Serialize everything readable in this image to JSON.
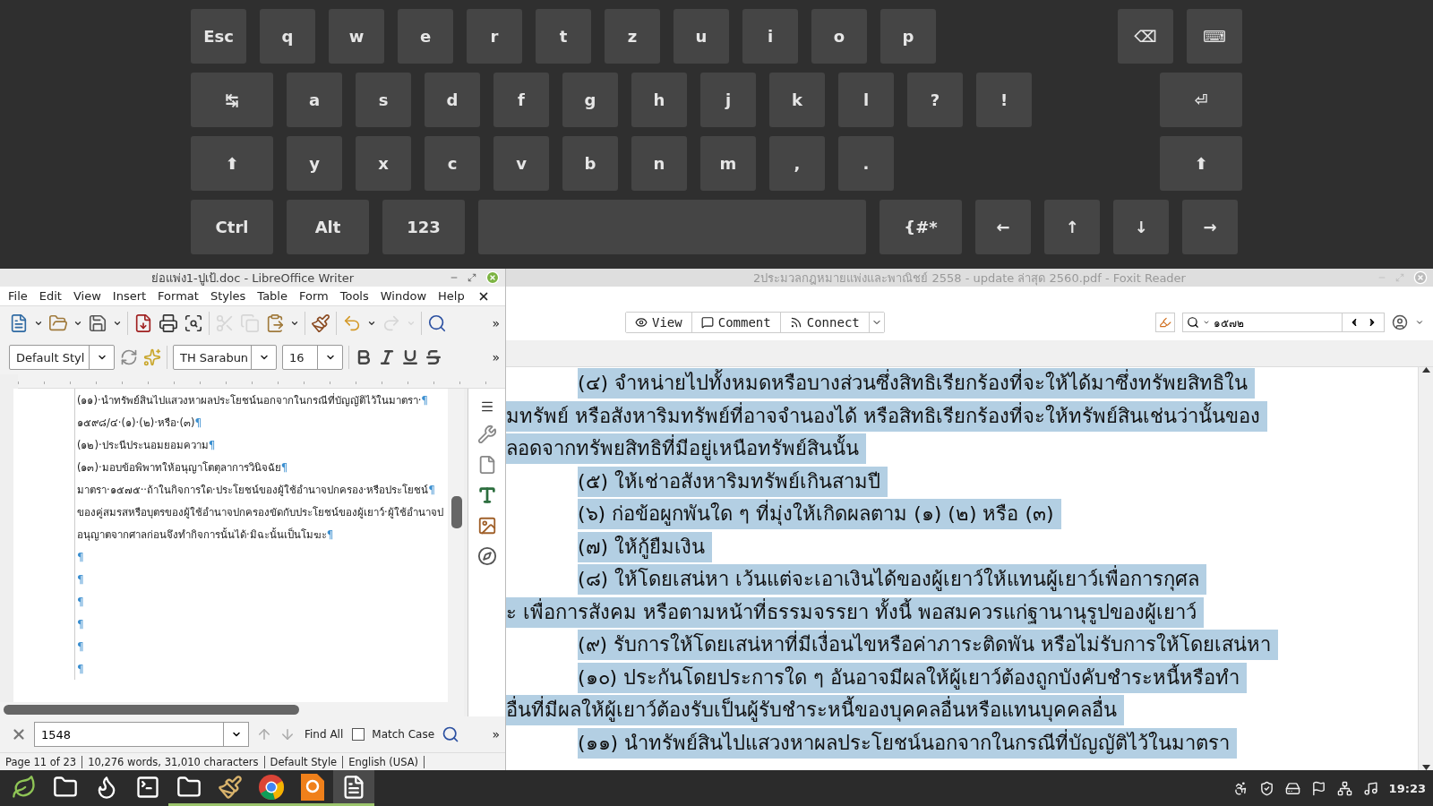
{
  "keyboard": {
    "rows": [
      {
        "left": [
          {
            "label": "Esc",
            "kind": "key"
          },
          {
            "label": "q",
            "kind": "key"
          },
          {
            "label": "w",
            "kind": "key"
          },
          {
            "label": "e",
            "kind": "key"
          },
          {
            "label": "r",
            "kind": "key"
          },
          {
            "label": "t",
            "kind": "key"
          },
          {
            "label": "z",
            "kind": "key"
          },
          {
            "label": "u",
            "kind": "key"
          },
          {
            "label": "i",
            "kind": "key"
          },
          {
            "label": "o",
            "kind": "key"
          },
          {
            "label": "p",
            "kind": "key"
          }
        ],
        "right": [
          {
            "label": "⌫",
            "kind": "key"
          },
          {
            "label": "⌨",
            "kind": "key"
          }
        ]
      },
      {
        "left": [
          {
            "label": "↹",
            "kind": "wide"
          },
          {
            "label": "a",
            "kind": "key"
          },
          {
            "label": "s",
            "kind": "key"
          },
          {
            "label": "d",
            "kind": "key"
          },
          {
            "label": "f",
            "kind": "key"
          },
          {
            "label": "g",
            "kind": "key"
          },
          {
            "label": "h",
            "kind": "key"
          },
          {
            "label": "j",
            "kind": "key"
          },
          {
            "label": "k",
            "kind": "key"
          },
          {
            "label": "l",
            "kind": "key"
          },
          {
            "label": "?",
            "kind": "key"
          },
          {
            "label": "!",
            "kind": "key"
          }
        ],
        "right": [
          {
            "label": "⏎",
            "kind": "wide"
          }
        ]
      },
      {
        "left": [
          {
            "label": "⬆",
            "kind": "wide"
          },
          {
            "label": "y",
            "kind": "key"
          },
          {
            "label": "x",
            "kind": "key"
          },
          {
            "label": "c",
            "kind": "key"
          },
          {
            "label": "v",
            "kind": "key"
          },
          {
            "label": "b",
            "kind": "key"
          },
          {
            "label": "n",
            "kind": "key"
          },
          {
            "label": "m",
            "kind": "key"
          },
          {
            "label": ",",
            "kind": "key"
          },
          {
            "label": ".",
            "kind": "key"
          }
        ],
        "right": [
          {
            "label": "⬆",
            "kind": "wide"
          }
        ]
      },
      {
        "left": [
          {
            "label": "Ctrl",
            "kind": "wide"
          },
          {
            "label": "Alt",
            "kind": "wide"
          },
          {
            "label": "123",
            "kind": "wide"
          },
          {
            "kind": "space"
          },
          {
            "label": "{#*",
            "kind": "wide"
          },
          {
            "label": "←",
            "kind": "key"
          },
          {
            "label": "↑",
            "kind": "key"
          },
          {
            "label": "↓",
            "kind": "key"
          },
          {
            "label": "→",
            "kind": "key"
          }
        ],
        "right": []
      }
    ]
  },
  "writer": {
    "title": "ย่อแพ่ง1-ปูเป้.doc - LibreOffice Writer",
    "menu": [
      "File",
      "Edit",
      "View",
      "Insert",
      "Format",
      "Styles",
      "Table",
      "Form",
      "Tools",
      "Window",
      "Help"
    ],
    "toolbar": [
      {
        "kind": "new",
        "disabled": false
      },
      {
        "kind": "dropdown",
        "disabled": false
      },
      {
        "kind": "open",
        "disabled": false
      },
      {
        "kind": "dropdown",
        "disabled": false
      },
      {
        "kind": "save",
        "disabled": false
      },
      {
        "kind": "dropdown",
        "disabled": false
      },
      {
        "kind": "sep"
      },
      {
        "kind": "pdf",
        "disabled": false
      },
      {
        "kind": "print",
        "disabled": false
      },
      {
        "kind": "preview",
        "disabled": false
      },
      {
        "kind": "sep"
      },
      {
        "kind": "cut",
        "disabled": true
      },
      {
        "kind": "copy",
        "disabled": true
      },
      {
        "kind": "paste",
        "disabled": false
      },
      {
        "kind": "dropdown",
        "disabled": false
      },
      {
        "kind": "sep"
      },
      {
        "kind": "clone",
        "disabled": false
      },
      {
        "kind": "sep"
      },
      {
        "kind": "undo",
        "disabled": false
      },
      {
        "kind": "dropdown",
        "disabled": false
      },
      {
        "kind": "redo",
        "disabled": true
      },
      {
        "kind": "dropdown",
        "disabled": true
      },
      {
        "kind": "sep"
      },
      {
        "kind": "findreplace",
        "disabled": false
      }
    ],
    "overflow": "»",
    "format": {
      "style": "Default Styl",
      "font": "TH Sarabun",
      "size": "16",
      "overflow": "»"
    },
    "paragraphs": [
      {
        "text": "(๑๑)·นำทรัพย์สินไปแสวงหาผลประโยชน์นอกจากในกรณีที่บัญญัติไว้ในมาตรา·",
        "end": "¶"
      },
      {
        "text": "๑๕๙๘/๔·(๑)·(๒)·หรือ·(๓)",
        "end": "¶"
      },
      {
        "text": "(๑๒)·ประนีประนอมยอมความ",
        "end": "¶"
      },
      {
        "text": "(๑๓)·มอบข้อพิพาทให้อนุญาโตตุลาการวินิจฉัย",
        "end": "¶"
      },
      {
        "text": "มาตรา·๑๕๗๕··ถ้าในกิจการใด·ประโยชน์ของผู้ใช้อำนาจปกครอง·หรือประโยชน์",
        "end": "¶"
      },
      {
        "text": "ของคู่สมรสหรือบุตรของผู้ใช้อำนาจปกครองขัดกับประโยชน์ของผู้เยาว์·ผู้ใช้อำนาจป"
      },
      {
        "text": "อนุญาตจากศาลก่อนจึงทำกิจการนั้นได้·มิฉะนั้นเป็นโมฆะ",
        "end": "¶"
      },
      {
        "end": "¶"
      },
      {
        "end": "¶"
      },
      {
        "end": "¶"
      },
      {
        "end": "¶"
      },
      {
        "end": "¶"
      },
      {
        "end": "¶"
      }
    ],
    "find": {
      "value": "1548",
      "find_all": "Find All",
      "match_case": {
        "label": "Match Case",
        "checked": false
      },
      "overflow": "»"
    },
    "status_bar": [
      "Page 11 of 23",
      "10,276 words, 31,010 characters",
      "Default Style",
      "English (USA)"
    ]
  },
  "foxit": {
    "title": "2ประมวลกฎหมายแพ่งและพาณิชย์ 2558  - update ล่าสุด 2560.pdf - Foxit Reader",
    "buttons": [
      {
        "label": "View",
        "kind": "view"
      },
      {
        "label": "Comment",
        "kind": "comment"
      },
      {
        "label": "Connect",
        "kind": "connect"
      }
    ],
    "search": {
      "value": "๑๕๗๒"
    },
    "lines": [
      {
        "text": "(๔) จำหน่ายไปทั้งหมดหรือบางส่วนซึ่งสิทธิเรียกร้องที่จะให้ได้มาซึ่งทรัพยสิทธิใน",
        "indent": true,
        "selected": true
      },
      {
        "text": "มทรัพย์ หรือสังหาริมทรัพย์ที่อาจจำนองได้ หรือสิทธิเรียกร้องที่จะให้ทรัพย์สินเช่นว่านั้นของ",
        "indent": false,
        "selected": true
      },
      {
        "text": "ลอดจากทรัพยสิทธิที่มีอยู่เหนือทรัพย์สินนั้น",
        "indent": false,
        "selected": true
      },
      {
        "text": "(๕) ให้เช่าอสังหาริมทรัพย์เกินสามปี",
        "indent": true,
        "selected": true
      },
      {
        "text": "(๖) ก่อข้อผูกพันใด ๆ ที่มุ่งให้เกิดผลตาม (๑) (๒) หรือ (๓)",
        "indent": true,
        "selected": true
      },
      {
        "text": "(๗) ให้กู้ยืมเงิน",
        "indent": true,
        "selected": true
      },
      {
        "text": "(๘) ให้โดยเสน่หา เว้นแต่จะเอาเงินได้ของผู้เยาว์ให้แทนผู้เยาว์เพื่อการกุศล",
        "indent": true,
        "selected": true
      },
      {
        "text": "ะ เพื่อการสังคม หรือตามหน้าที่ธรรมจรรยา  ทั้งนี้ พอสมควรแก่ฐานานุรูปของผู้เยาว์",
        "indent": false,
        "selected": true
      },
      {
        "text": "(๙) รับการให้โดยเสน่หาที่มีเงื่อนไขหรือค่าภาระติดพัน หรือไม่รับการให้โดยเสน่หา",
        "indent": true,
        "selected": true
      },
      {
        "text": "(๑๐) ประกันโดยประการใด ๆ อันอาจมีผลให้ผู้เยาว์ต้องถูกบังคับชำระหนี้หรือทำ",
        "indent": true,
        "selected": true
      },
      {
        "text": "อื่นที่มีผลให้ผู้เยาว์ต้องรับเป็นผู้รับชำระหนี้ของบุคคลอื่นหรือแทนบุคคลอื่น",
        "indent": false,
        "selected": true
      },
      {
        "text": "(๑๑) นำทรัพย์สินไปแสวงหาผลประโยชน์นอกจากในกรณีที่บัญญัติไว้ในมาตรา",
        "indent": true,
        "selected": true
      }
    ]
  },
  "taskbar": {
    "apps": [
      {
        "kind": "mint",
        "active": false,
        "running": false
      },
      {
        "kind": "folder",
        "active": false,
        "running": false
      },
      {
        "kind": "firefox",
        "active": false,
        "running": false
      },
      {
        "kind": "terminal",
        "active": false,
        "running": false
      },
      {
        "kind": "folder",
        "active": false,
        "running": true
      },
      {
        "kind": "brush",
        "active": false,
        "running": true
      },
      {
        "kind": "chrome",
        "active": false,
        "running": true
      },
      {
        "kind": "pdf",
        "active": false,
        "running": true
      },
      {
        "kind": "writer",
        "active": true,
        "running": true
      }
    ],
    "clock": "19:23"
  }
}
